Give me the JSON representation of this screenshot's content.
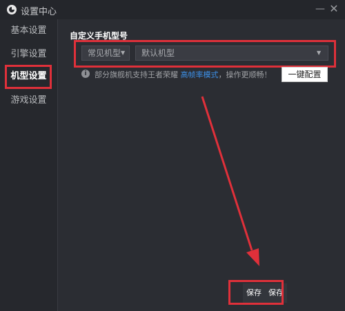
{
  "window": {
    "title": "设置中心",
    "minimize_symbol": "—",
    "close_symbol": "✕"
  },
  "sidebar": {
    "items": [
      {
        "label": "基本设置"
      },
      {
        "label": "引擎设置"
      },
      {
        "label": "机型设置",
        "active": true
      },
      {
        "label": "游戏设置"
      }
    ]
  },
  "main": {
    "section_title": "自定义手机型号",
    "type_select": {
      "value": "常见机型"
    },
    "model_select": {
      "value": "默认机型"
    },
    "tip": {
      "prefix": "部分旗舰机支持王者荣耀 ",
      "link": "高帧率模式",
      "suffix": "，操作更顺畅！"
    },
    "info_icon_char": "i",
    "one_key_button": "一键配置"
  },
  "footer": {
    "save_label_1": "保存",
    "save_label_2": "保存"
  },
  "annotations": {
    "highlight_color": "#e0303a"
  }
}
